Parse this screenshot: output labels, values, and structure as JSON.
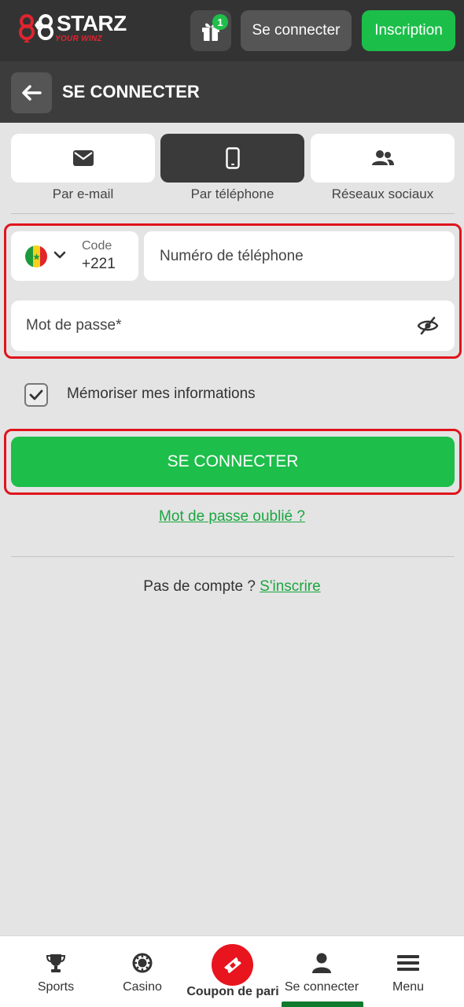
{
  "header": {
    "logo_text": "STARZ",
    "logo_tagline": "YOUR WINZ",
    "gift_badge": "1",
    "login_label": "Se connecter",
    "signup_label": "Inscription"
  },
  "page": {
    "title": "SE CONNECTER"
  },
  "tabs": [
    {
      "label": "Par e-mail",
      "icon": "envelope-icon",
      "active": false
    },
    {
      "label": "Par téléphone",
      "icon": "phone-icon",
      "active": true
    },
    {
      "label": "Réseaux sociaux",
      "icon": "users-icon",
      "active": false
    }
  ],
  "form": {
    "country_flag": "senegal-flag",
    "code_label": "Code",
    "code_value": "+221",
    "phone_placeholder": "Numéro de téléphone",
    "password_placeholder": "Mot de passe*",
    "remember_label": "Mémoriser mes informations",
    "remember_checked": true,
    "submit_label": "SE CONNECTER",
    "forgot_label": "Mot de passe oublié ?",
    "no_account_text": "Pas de compte ?",
    "register_link": "S'inscrire"
  },
  "bottom_nav": [
    {
      "label": "Sports",
      "icon": "trophy-icon"
    },
    {
      "label": "Casino",
      "icon": "casino-chip-icon"
    },
    {
      "label": "Coupon de pari",
      "icon": "ticket-icon"
    },
    {
      "label": "Se connecter",
      "icon": "user-icon",
      "active": true
    },
    {
      "label": "Menu",
      "icon": "hamburger-icon"
    }
  ],
  "colors": {
    "brand_green": "#1dbe4a",
    "brand_red": "#e8141e",
    "header_dark": "#333333",
    "highlight_outline": "#e0141c"
  }
}
